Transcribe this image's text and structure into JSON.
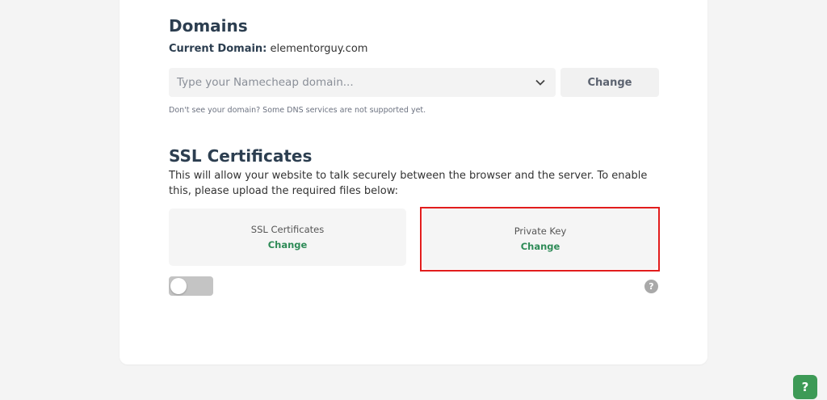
{
  "domains": {
    "title": "Domains",
    "current_label": "Current Domain:",
    "current_value": "elementorguy.com",
    "select_placeholder": "Type your Namecheap domain...",
    "change_button": "Change",
    "hint": "Don't see your domain? Some DNS services are not supported yet.",
    "icons": {
      "dropdown": "chevron-down-icon"
    }
  },
  "ssl": {
    "title": "SSL Certificates",
    "description": "This will allow your website to talk securely between the browser and the server. To enable this, please upload the required files below:",
    "boxes": [
      {
        "label": "SSL Certificates",
        "action": "Change"
      },
      {
        "label": "Private Key",
        "action": "Change"
      }
    ],
    "toggle_on": false,
    "help_icon": "?"
  },
  "help_button": "?",
  "colors": {
    "accent_green": "#2e8b57",
    "highlight_red": "#e21d1d",
    "fab_green": "#3d9a56"
  }
}
